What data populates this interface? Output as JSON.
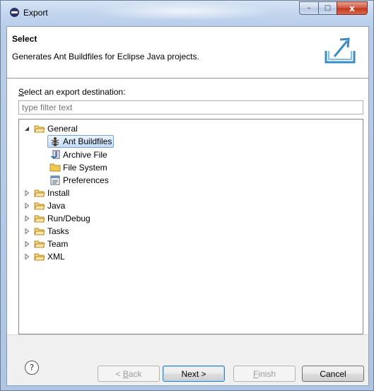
{
  "window": {
    "title": "Export",
    "controls": {
      "minimize": "–",
      "maximize": "□",
      "close": "x"
    }
  },
  "header": {
    "title": "Select",
    "description": "Generates Ant Buildfiles for Eclipse Java projects."
  },
  "destination": {
    "label_mnemonic": "S",
    "label_rest": "elect an export destination:",
    "filter_placeholder": "type filter text"
  },
  "tree": {
    "general": {
      "label": "General",
      "expanded": true,
      "children": [
        {
          "label": "Ant Buildfiles",
          "icon": "ant-icon",
          "selected": true
        },
        {
          "label": "Archive File",
          "icon": "archive-file-icon"
        },
        {
          "label": "File System",
          "icon": "folder-icon"
        },
        {
          "label": "Preferences",
          "icon": "preferences-icon"
        }
      ]
    },
    "categories": [
      {
        "label": "Install"
      },
      {
        "label": "Java"
      },
      {
        "label": "Run/Debug"
      },
      {
        "label": "Tasks"
      },
      {
        "label": "Team"
      },
      {
        "label": "XML"
      }
    ]
  },
  "footer": {
    "help": "?",
    "back_prefix": "< ",
    "back_mnemonic": "B",
    "back_rest": "ack",
    "next": "Next >",
    "finish_mnemonic": "F",
    "finish_rest": "inish",
    "cancel": "Cancel"
  },
  "colors": {
    "selection_border": "#7da2ce",
    "folder": "#e8b64c"
  }
}
